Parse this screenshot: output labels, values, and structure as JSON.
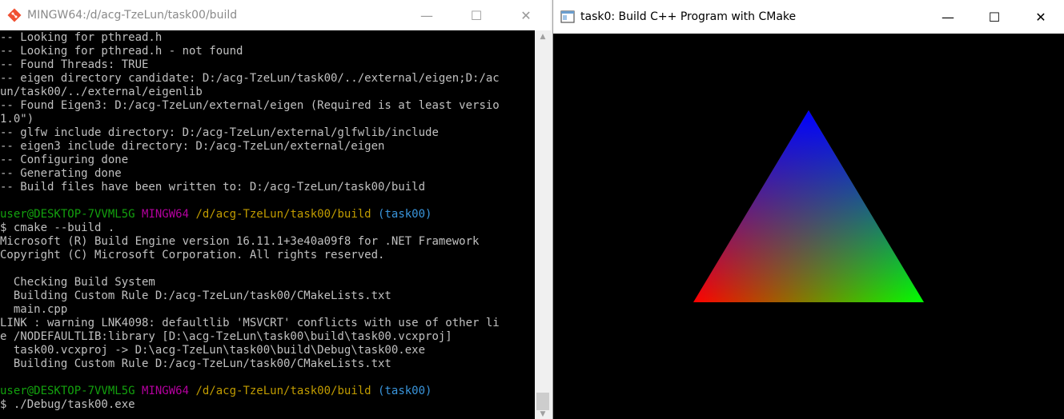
{
  "terminal_window": {
    "title": "MINGW64:/d/acg-TzeLun/task00/build",
    "minimize": "—",
    "maximize": "☐",
    "close": "✕",
    "lines": [
      [
        {
          "t": "-- Looking for pthread.h",
          "c": "default"
        }
      ],
      [
        {
          "t": "-- Looking for pthread.h - not found",
          "c": "default"
        }
      ],
      [
        {
          "t": "-- Found Threads: TRUE",
          "c": "default"
        }
      ],
      [
        {
          "t": "-- eigen directory candidate: D:/acg-TzeLun/task00/../external/eigen;D:/ac",
          "c": "default"
        }
      ],
      [
        {
          "t": "un/task00/../external/eigenlib",
          "c": "default"
        }
      ],
      [
        {
          "t": "-- Found Eigen3: D:/acg-TzeLun/external/eigen (Required is at least versio",
          "c": "default"
        }
      ],
      [
        {
          "t": "1.0\")",
          "c": "default"
        }
      ],
      [
        {
          "t": "-- glfw include directory: D:/acg-TzeLun/external/glfwlib/include",
          "c": "default"
        }
      ],
      [
        {
          "t": "-- eigen3 include directory: D:/acg-TzeLun/external/eigen",
          "c": "default"
        }
      ],
      [
        {
          "t": "-- Configuring done",
          "c": "default"
        }
      ],
      [
        {
          "t": "-- Generating done",
          "c": "default"
        }
      ],
      [
        {
          "t": "-- Build files have been written to: D:/acg-TzeLun/task00/build",
          "c": "default"
        }
      ],
      [
        {
          "t": "",
          "c": "default"
        }
      ],
      [
        {
          "t": "user@DESKTOP-7VVML5G ",
          "c": "user"
        },
        {
          "t": "MINGW64 ",
          "c": "ming"
        },
        {
          "t": "/d/acg-TzeLun/task00/build ",
          "c": "path"
        },
        {
          "t": "(task00)",
          "c": "branch"
        }
      ],
      [
        {
          "t": "$ cmake --build .",
          "c": "default"
        }
      ],
      [
        {
          "t": "Microsoft (R) Build Engine version 16.11.1+3e40a09f8 for .NET Framework",
          "c": "default"
        }
      ],
      [
        {
          "t": "Copyright (C) Microsoft Corporation. All rights reserved.",
          "c": "default"
        }
      ],
      [
        {
          "t": "",
          "c": "default"
        }
      ],
      [
        {
          "t": "  Checking Build System",
          "c": "default"
        }
      ],
      [
        {
          "t": "  Building Custom Rule D:/acg-TzeLun/task00/CMakeLists.txt",
          "c": "default"
        }
      ],
      [
        {
          "t": "  main.cpp",
          "c": "default"
        }
      ],
      [
        {
          "t": "LINK : warning LNK4098: defaultlib 'MSVCRT' conflicts with use of other li",
          "c": "default"
        }
      ],
      [
        {
          "t": "e /NODEFAULTLIB:library [D:\\acg-TzeLun\\task00\\build\\task00.vcxproj]",
          "c": "default"
        }
      ],
      [
        {
          "t": "  task00.vcxproj -> D:\\acg-TzeLun\\task00\\build\\Debug\\task00.exe",
          "c": "default"
        }
      ],
      [
        {
          "t": "  Building Custom Rule D:/acg-TzeLun/task00/CMakeLists.txt",
          "c": "default"
        }
      ],
      [
        {
          "t": "",
          "c": "default"
        }
      ],
      [
        {
          "t": "user@DESKTOP-7VVML5G ",
          "c": "user"
        },
        {
          "t": "MINGW64 ",
          "c": "ming"
        },
        {
          "t": "/d/acg-TzeLun/task00/build ",
          "c": "path"
        },
        {
          "t": "(task00)",
          "c": "branch"
        }
      ],
      [
        {
          "t": "$ ./Debug/task00.exe",
          "c": "default"
        }
      ]
    ]
  },
  "gl_window": {
    "title": "task0: Build C++ Program with CMake",
    "minimize": "—",
    "maximize": "☐",
    "close": "✕",
    "vertex_colors": {
      "top": "#0000ff",
      "bottom_left": "#ff0000",
      "bottom_right": "#00ff00"
    }
  }
}
